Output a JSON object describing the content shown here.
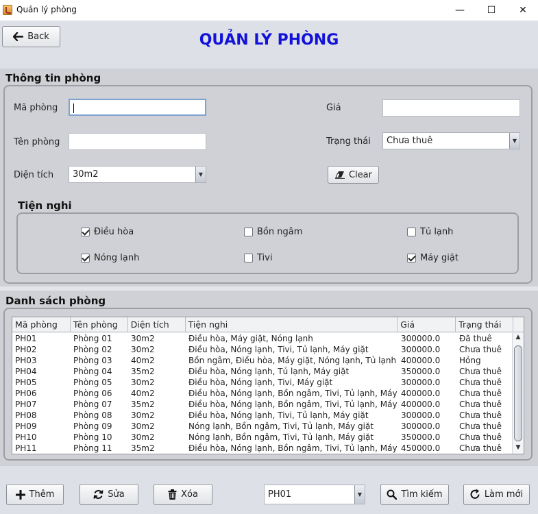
{
  "window": {
    "title": "Quản lý phòng",
    "minimize": "—",
    "maximize": "☐",
    "close": "✕"
  },
  "header": {
    "back_label": "Back",
    "page_title": "QUẢN LÝ PHÒNG"
  },
  "info": {
    "section_title": "Thông tin phòng",
    "ma_phong": {
      "label": "Mã phòng",
      "value": ""
    },
    "ten_phong": {
      "label": "Tên phòng",
      "value": ""
    },
    "dien_tich": {
      "label": "Diện tích",
      "value": "30m2"
    },
    "gia": {
      "label": "Giá",
      "value": ""
    },
    "trang_thai": {
      "label": "Trạng thái",
      "value": "Chưa thuê"
    },
    "clear_label": "Clear"
  },
  "amenities": {
    "title": "Tiện nghi",
    "items": [
      {
        "label": "Điều hòa",
        "checked": true
      },
      {
        "label": "Bồn ngâm",
        "checked": false
      },
      {
        "label": "Tủ lạnh",
        "checked": false
      },
      {
        "label": "Nóng lạnh",
        "checked": true
      },
      {
        "label": "Tivi",
        "checked": false
      },
      {
        "label": "Máy giặt",
        "checked": true
      }
    ]
  },
  "list": {
    "section_title": "Danh sách phòng",
    "columns": [
      "Mã phòng",
      "Tên phòng",
      "Diện tích",
      "Tiện nghi",
      "Giá",
      "Trạng thái"
    ],
    "rows": [
      [
        "PH01",
        "Phòng 01",
        "30m2",
        "Điều hòa, Máy giặt, Nóng lạnh",
        "300000.0",
        "Đã thuê"
      ],
      [
        "PH02",
        "Phòng 02",
        "30m2",
        "Điều hòa, Nóng lạnh, Tivi, Tủ lạnh, Máy giặt",
        "300000.0",
        "Chưa thuê"
      ],
      [
        "PH03",
        "Phòng 03",
        "40m2",
        "Bồn ngâm, Điều hòa, Máy giặt, Nóng lạnh, Tủ lạnh",
        "400000.0",
        "Hỏng"
      ],
      [
        "PH04",
        "Phòng 04",
        "35m2",
        "Điều hòa, Nóng lạnh, Tủ lạnh, Máy giặt",
        "350000.0",
        "Chưa thuê"
      ],
      [
        "PH05",
        "Phòng 05",
        "30m2",
        "Điều hòa, Nóng lạnh, Tivi,  Máy giặt",
        "300000.0",
        "Chưa thuê"
      ],
      [
        "PH06",
        "Phòng 06",
        "40m2",
        "Điều hòa, Nóng lạnh, Bồn ngâm, Tivi, Tủ lạnh, Máy giặt",
        "400000.0",
        "Chưa thuê"
      ],
      [
        "PH07",
        "Phòng 07",
        "35m2",
        "Điều hòa, Nóng lạnh, Bồn ngâm, Tivi, Tủ lạnh, Máy giặt",
        "400000.0",
        "Chưa thuê"
      ],
      [
        "PH08",
        "Phòng 08",
        "30m2",
        "Điều hòa, Nóng lạnh, Tivi, Tủ lạnh, Máy giặt",
        "300000.0",
        "Chưa thuê"
      ],
      [
        "PH09",
        "Phòng 09",
        "30m2",
        "Nóng lạnh, Bồn ngâm, Tivi, Tủ lạnh, Máy giặt",
        "300000.0",
        "Chưa thuê"
      ],
      [
        "PH10",
        "Phòng 10",
        "30m2",
        "Nóng lạnh, Bồn ngâm, Tivi, Tủ lạnh, Máy giặt",
        "350000.0",
        "Chưa thuê"
      ],
      [
        "PH11",
        "Phòng 11",
        "35m2",
        "Điều hòa, Nóng lạnh, Bồn ngâm, Tivi, Tủ lạnh, Máy giặt",
        "450000.0",
        "Chưa thuê"
      ]
    ]
  },
  "footer": {
    "add_label": "Thêm",
    "edit_label": "Sửa",
    "delete_label": "Xóa",
    "select_value": "PH01",
    "search_label": "Tìm kiếm",
    "refresh_label": "Làm mới"
  },
  "colors": {
    "title_blue": "#1212d8",
    "panel": "#cfd1d6",
    "background": "#dde0e6"
  }
}
